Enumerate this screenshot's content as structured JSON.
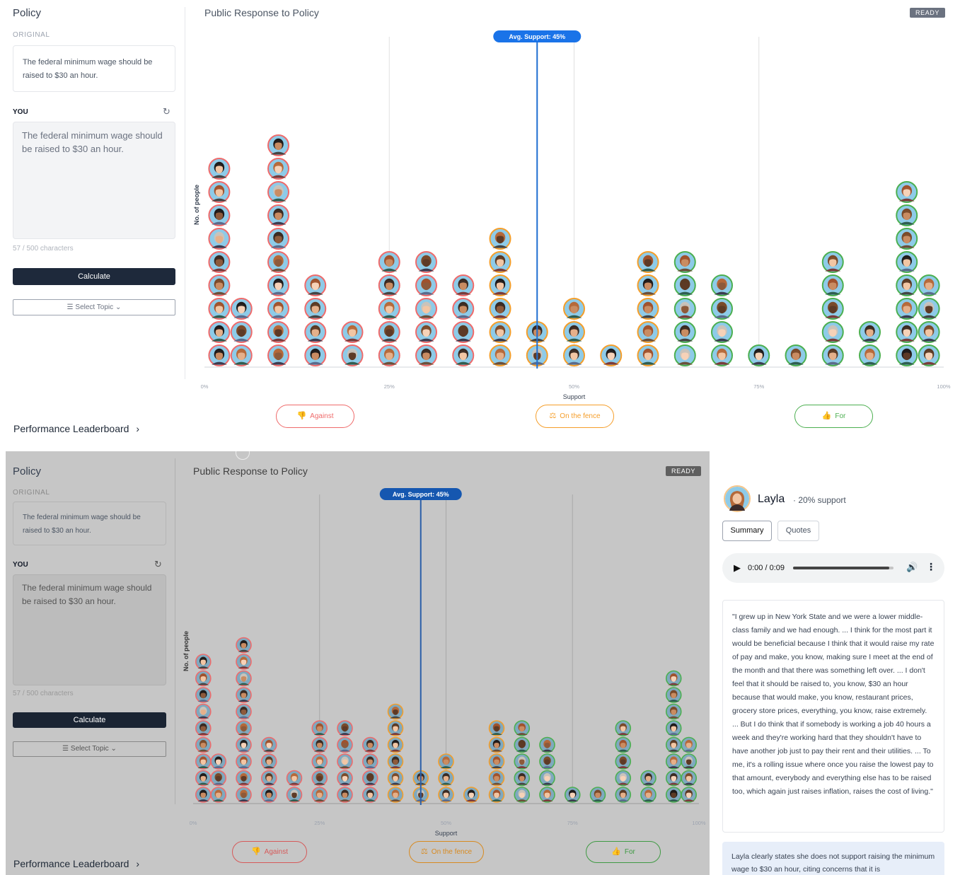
{
  "sidebar": {
    "title": "Policy",
    "original_label": "ORIGINAL",
    "original_text": "The federal minimum wage should be raised to $30 an hour.",
    "you_label": "YOU",
    "you_text": "The federal minimum wage should be raised to $30 an hour.",
    "char_count": "57 / 500 characters",
    "calculate_label": "Calculate",
    "select_topic_label": "Select Topic",
    "leaderboard_label": "Performance Leaderboard"
  },
  "main": {
    "title": "Public Response to Policy",
    "status": "READY",
    "ylabel": "No. of people",
    "xlabel": "Support",
    "avg_label": "Avg. Support: 45%",
    "filters": {
      "against": "Against",
      "fence": "On the fence",
      "for": "For"
    }
  },
  "chart_data": {
    "type": "dot-histogram",
    "xlabel": "Support",
    "ylabel": "No. of people",
    "xlim": [
      0,
      100
    ],
    "x_ticks": [
      "0%",
      "25%",
      "50%",
      "75%",
      "100%"
    ],
    "average_support": 45,
    "bins": [
      {
        "support": 2,
        "count": 9
      },
      {
        "support": 5,
        "count": 3
      },
      {
        "support": 10,
        "count": 10
      },
      {
        "support": 15,
        "count": 4
      },
      {
        "support": 20,
        "count": 2
      },
      {
        "support": 25,
        "count": 5
      },
      {
        "support": 30,
        "count": 5
      },
      {
        "support": 35,
        "count": 4
      },
      {
        "support": 40,
        "count": 6
      },
      {
        "support": 45,
        "count": 2
      },
      {
        "support": 50,
        "count": 3
      },
      {
        "support": 55,
        "count": 1
      },
      {
        "support": 60,
        "count": 5
      },
      {
        "support": 65,
        "count": 5
      },
      {
        "support": 70,
        "count": 4
      },
      {
        "support": 75,
        "count": 1
      },
      {
        "support": 80,
        "count": 1
      },
      {
        "support": 85,
        "count": 5
      },
      {
        "support": 90,
        "count": 2
      },
      {
        "support": 95,
        "count": 8
      },
      {
        "support": 98,
        "count": 4
      }
    ]
  },
  "persona": {
    "name": "Layla",
    "support": "· 20% support",
    "tabs": [
      "Summary",
      "Quotes"
    ],
    "audio_time": "0:00 / 0:09",
    "audio_progress": 0.96,
    "quote": "\"I grew up in New York State and we were a lower middle-class family and we had enough. ... I think for the most part it would be beneficial because I think that it would raise my rate of pay and make, you know, making sure I meet at the end of the month and that there was something left over. ... I don't feel that it should be raised to, you know, $30 an hour because that would make, you know, restaurant prices, grocery store prices, everything, you know, raise extremely. ... But I do think that if somebody is working a job 40 hours a week and they're working hard that they shouldn't have to have another job just to pay their rent and their utilities. ... To me, it's a rolling issue where once you raise the lowest pay to that amount, everybody and everything else has to be raised too, which again just raises inflation, raises the cost of living.\"",
    "summary": "Layla clearly states she does not support raising the minimum wage to $30 an hour, citing concerns that it is"
  },
  "colors": {
    "against": "#ef6b6b",
    "fence": "#f59e2a",
    "for": "#4caf50",
    "avg_line": "#1f6fd1",
    "avg_badge": "#1a73e8",
    "calc_button": "#1e293b"
  }
}
